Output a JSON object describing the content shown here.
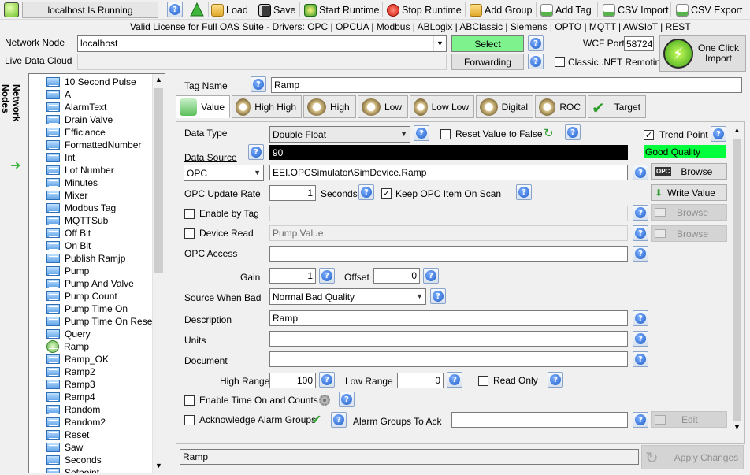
{
  "toolbar": {
    "status": "localhost Is Running",
    "load": "Load",
    "save": "Save",
    "start_runtime": "Start Runtime",
    "stop_runtime": "Stop Runtime",
    "add_group": "Add Group",
    "add_tag": "Add Tag",
    "csv_import": "CSV Import",
    "csv_export": "CSV Export"
  },
  "license": "Valid License for Full OAS Suite - Drivers: OPC | OPCUA | Modbus | ABLogix | ABClassic | Siemens | OPTO | MQTT | AWSIoT | REST",
  "network": {
    "node_label": "Network Node",
    "node_value": "localhost",
    "select_label": "Select",
    "forwarding_label": "Forwarding",
    "live_data_cloud_label": "Live Data Cloud",
    "wcf_port_label": "WCF Port",
    "wcf_port_value": "58724",
    "classic_remoting_label": "Classic .NET Remoting",
    "one_click_import_label": "One Click Import"
  },
  "sidebar": {
    "title": "Network Nodes"
  },
  "tree": {
    "items": [
      "10 Second Pulse",
      "A",
      "AlarmText",
      "Drain Valve",
      "Efficiance",
      "FormattedNumber",
      "Int",
      "Lot Number",
      "Minutes",
      "Mixer",
      "Modbus Tag",
      "MQTTSub",
      "Off Bit",
      "On Bit",
      "Publish Ramjp",
      "Pump",
      "Pump And Valve",
      "Pump Count",
      "Pump Time On",
      "Pump Time On Reset",
      "Query",
      "Ramp",
      "Ramp_OK",
      "Ramp2",
      "Ramp3",
      "Ramp4",
      "Random",
      "Random2",
      "Reset",
      "Saw",
      "Seconds",
      "Setpoint"
    ],
    "selected": "Ramp"
  },
  "tag": {
    "name_label": "Tag Name",
    "name_value": "Ramp"
  },
  "tabs": [
    "Value",
    "High High",
    "High",
    "Low",
    "Low Low",
    "Digital",
    "ROC",
    "Target"
  ],
  "form": {
    "data_type_label": "Data Type",
    "data_type_value": "Double Float",
    "reset_value_label": "Reset Value to False",
    "trend_point_label": "Trend Point",
    "quality_value": "Good Quality",
    "data_source_label": "Data Source",
    "current_value": "90",
    "source_type": "OPC",
    "opc_item": "EEI.OPCSimulator\\SimDevice.Ramp",
    "browse_label": "Browse",
    "opc_update_rate_label": "OPC Update Rate",
    "opc_update_rate_value": "1",
    "seconds_label": "Seconds",
    "keep_opc_label": "Keep OPC Item On Scan",
    "write_value_label": "Write Value",
    "enable_by_tag_label": "Enable by Tag",
    "device_read_label": "Device Read",
    "device_read_value": "Pump.Value",
    "opc_access_label": "OPC Access",
    "gain_label": "Gain",
    "gain_value": "1",
    "offset_label": "Offset",
    "offset_value": "0",
    "source_when_bad_label": "Source When Bad",
    "source_when_bad_value": "Normal Bad Quality",
    "description_label": "Description",
    "description_value": "Ramp",
    "units_label": "Units",
    "document_label": "Document",
    "high_range_label": "High Range",
    "high_range_value": "100",
    "low_range_label": "Low Range",
    "low_range_value": "0",
    "read_only_label": "Read Only",
    "enable_time_on_label": "Enable Time On and Counts",
    "ack_alarm_groups_label": "Acknowledge Alarm Groups",
    "alarm_groups_to_ack_label": "Alarm Groups To Ack",
    "edit_label": "Edit"
  },
  "footer": {
    "tag_path": "Ramp",
    "apply_changes": "Apply Changes"
  },
  "colors": {
    "quality_green": "#00ff3c",
    "value_bg": "#000000"
  }
}
